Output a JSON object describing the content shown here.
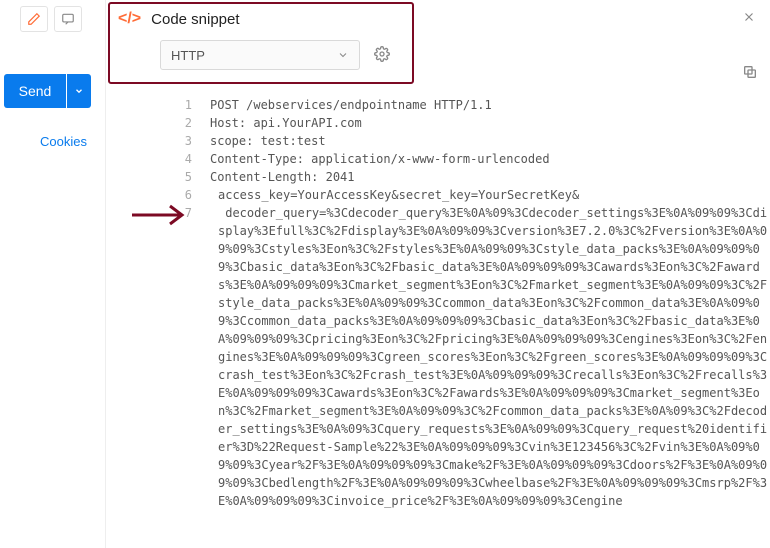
{
  "left": {
    "send_label": "Send",
    "cookies_label": "Cookies"
  },
  "panel": {
    "title": "Code snippet",
    "language": "HTTP"
  },
  "code": {
    "lines": [
      "POST /webservices/endpointname HTTP/1.1",
      "Host: api.YourAPI.com",
      "scope: test:test",
      "Content-Type: application/x-www-form-urlencoded",
      "Content-Length: 2041",
      ""
    ],
    "body": "access_key=YourAccessKey&secret_key=YourSecretKey&\n decoder_query=%3Cdecoder_query%3E%0A%09%3Cdecoder_settings%3E%0A%09%09%3Cdisplay%3Efull%3C%2Fdisplay%3E%0A%09%09%3Cversion%3E7.2.0%3C%2Fversion%3E%0A%09%09%3Cstyles%3Eon%3C%2Fstyles%3E%0A%09%09%3Cstyle_data_packs%3E%0A%09%09%09%3Cbasic_data%3Eon%3C%2Fbasic_data%3E%0A%09%09%09%3Cawards%3Eon%3C%2Fawards%3E%0A%09%09%09%3Cmarket_segment%3Eon%3C%2Fmarket_segment%3E%0A%09%09%3C%2Fstyle_data_packs%3E%0A%09%09%3Ccommon_data%3Eon%3C%2Fcommon_data%3E%0A%09%09%3Ccommon_data_packs%3E%0A%09%09%09%3Cbasic_data%3Eon%3C%2Fbasic_data%3E%0A%09%09%09%3Cpricing%3Eon%3C%2Fpricing%3E%0A%09%09%09%3Cengines%3Eon%3C%2Fengines%3E%0A%09%09%09%3Cgreen_scores%3Eon%3C%2Fgreen_scores%3E%0A%09%09%09%3Ccrash_test%3Eon%3C%2Fcrash_test%3E%0A%09%09%09%3Crecalls%3Eon%3C%2Frecalls%3E%0A%09%09%09%3Cawards%3Eon%3C%2Fawards%3E%0A%09%09%09%3Cmarket_segment%3Eon%3C%2Fmarket_segment%3E%0A%09%09%3C%2Fcommon_data_packs%3E%0A%09%3C%2Fdecoder_settings%3E%0A%09%3Cquery_requests%3E%0A%09%09%3Cquery_request%20identifier%3D%22Request-Sample%22%3E%0A%09%09%09%3Cvin%3E123456%3C%2Fvin%3E%0A%09%09%09%3Cyear%2F%3E%0A%09%09%09%3Cmake%2F%3E%0A%09%09%09%3Cdoors%2F%3E%0A%09%09%09%3Cbedlength%2F%3E%0A%09%09%09%3Cwheelbase%2F%3E%0A%09%09%09%3Cmsrp%2F%3E%0A%09%09%09%3Cinvoice_price%2F%3E%0A%09%09%09%3Cengine"
  }
}
